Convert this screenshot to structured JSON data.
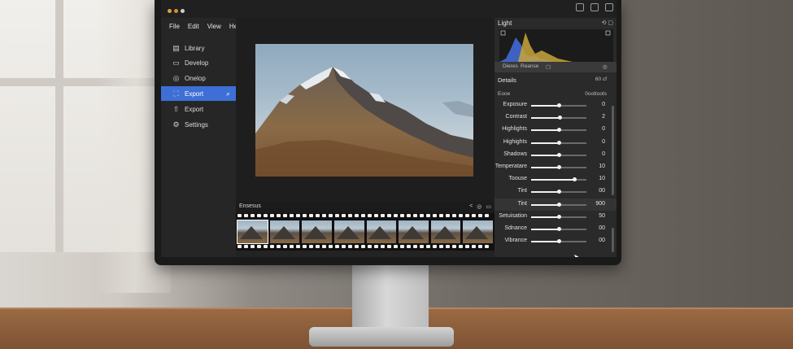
{
  "titlebar": {
    "dots": [
      "#e0a040",
      "#d88a3a",
      "#cfcfcf"
    ]
  },
  "menu": [
    "File",
    "Edit",
    "View",
    "Help"
  ],
  "nav": [
    {
      "label": "Library",
      "icon": "library-icon",
      "glyph": "▤"
    },
    {
      "label": "Develop",
      "icon": "develop-icon",
      "glyph": "▭"
    },
    {
      "label": "Onelop",
      "icon": "onelop-icon",
      "glyph": "◎"
    },
    {
      "label": "Export",
      "icon": "export-icon",
      "glyph": "⛶",
      "active": true
    },
    {
      "label": "Export",
      "icon": "export-arrow-icon",
      "glyph": "⇧"
    },
    {
      "label": "Settings",
      "icon": "gear-icon",
      "glyph": "⚙"
    }
  ],
  "filmstrip": {
    "title": "Ensesus",
    "frame_count": 8,
    "selected_index": 0
  },
  "panel": {
    "title": "Light",
    "histogram_labels": [
      "Dieres",
      "Reanse"
    ],
    "details_title": "Details",
    "details_value": "60 cf",
    "tone_label": "Eooe",
    "tone_right": "0oottoots"
  },
  "sliders": [
    {
      "label": "Exposure",
      "value": "0",
      "pos": 0.5
    },
    {
      "label": "Contrast",
      "value": "2",
      "pos": 0.52
    },
    {
      "label": "Highlights",
      "value": "0",
      "pos": 0.5
    },
    {
      "label": "Highights",
      "value": "0",
      "pos": 0.5
    },
    {
      "label": "Shadows",
      "value": "0",
      "pos": 0.5
    },
    {
      "label": "Temperatare",
      "value": "10",
      "pos": 0.5
    },
    {
      "label": "Toouse",
      "value": "10",
      "pos": 0.78
    },
    {
      "label": "Tint",
      "value": "00",
      "pos": 0.5
    },
    {
      "label": "Tint",
      "value": "900",
      "pos": 0.5,
      "highlight": true
    },
    {
      "label": "Setuisation",
      "value": "50",
      "pos": 0.5
    },
    {
      "label": "Sdnance",
      "value": "00",
      "pos": 0.5
    },
    {
      "label": "Vibrance",
      "value": "00",
      "pos": 0.5
    }
  ]
}
